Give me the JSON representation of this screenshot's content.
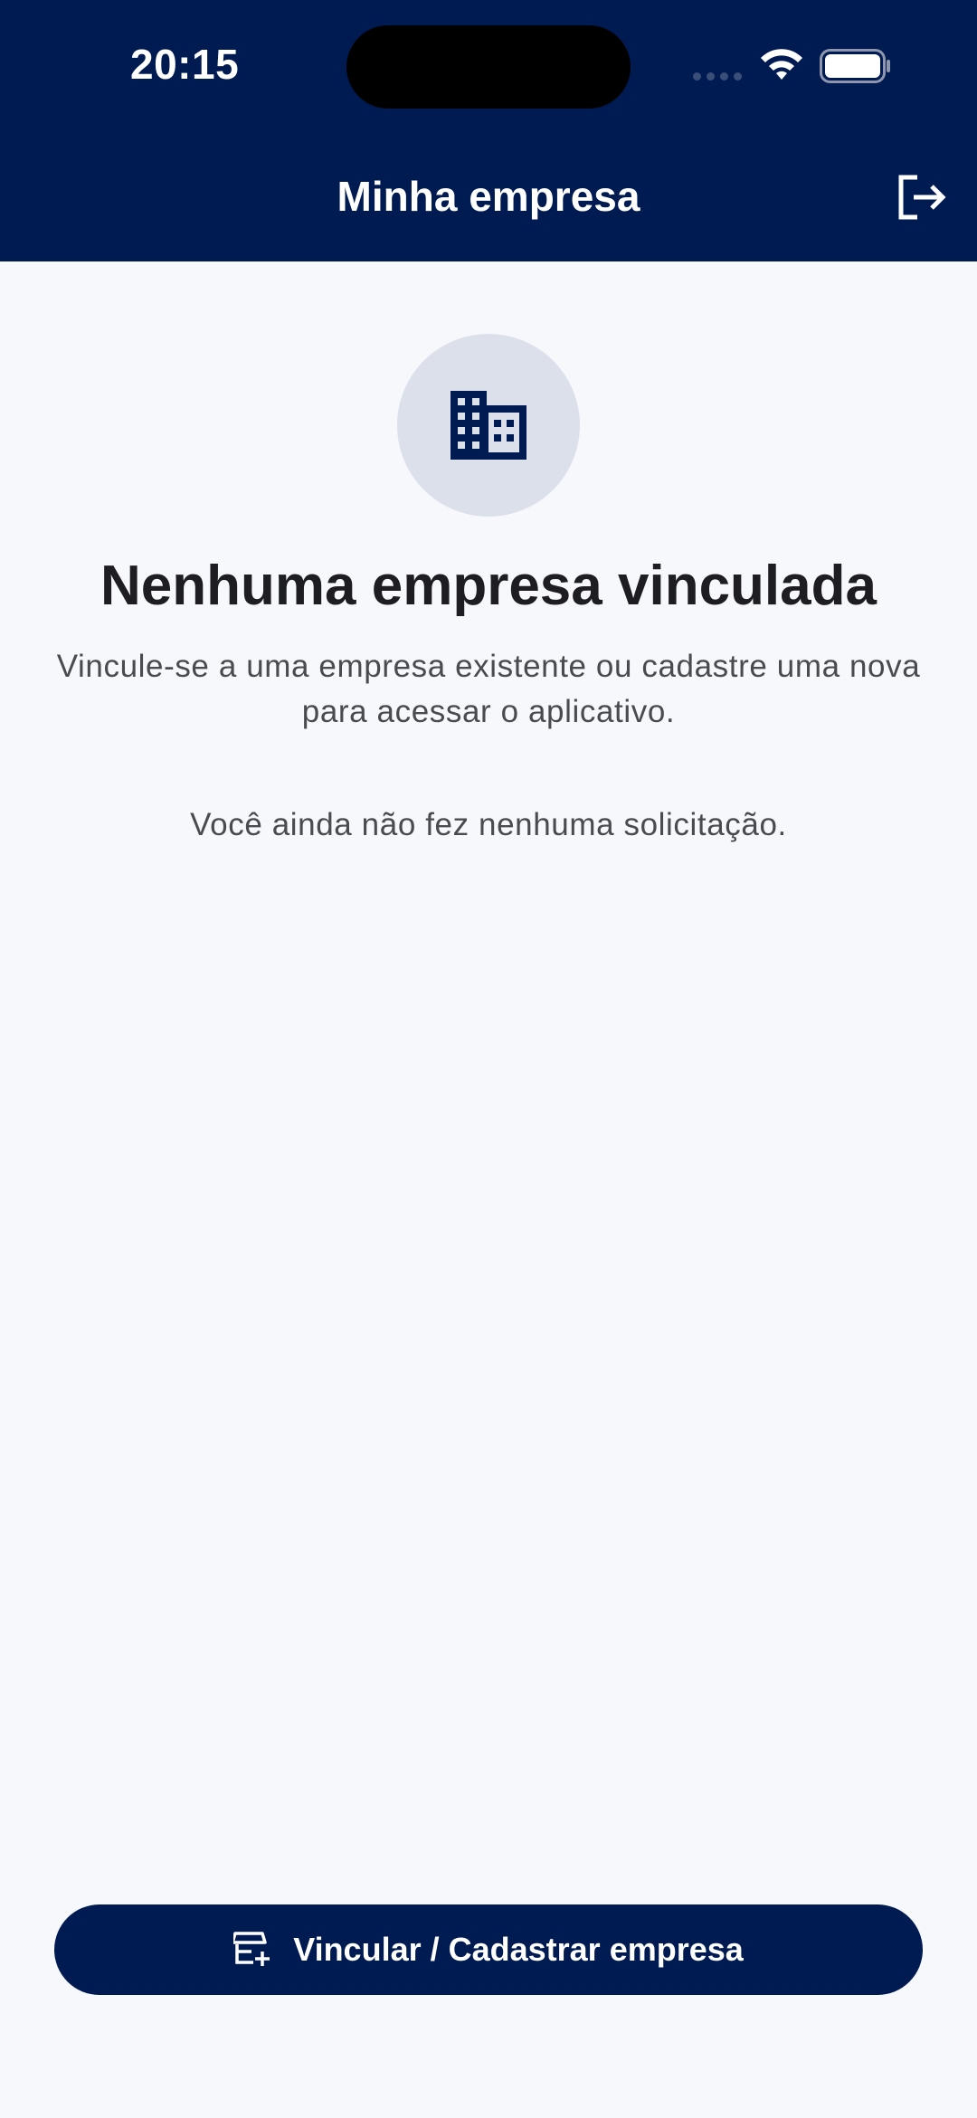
{
  "status_bar": {
    "time": "20:15"
  },
  "header": {
    "title": "Minha empresa",
    "logout_icon": "logout-icon"
  },
  "empty_state": {
    "icon": "building-icon",
    "title": "Nenhuma empresa vinculada",
    "description": "Vincule-se a uma empresa existente ou cadastre uma nova para acessar o aplicativo.",
    "no_requests": "Você ainda não fez nenhuma solicitação."
  },
  "action": {
    "icon": "store-add-icon",
    "label": "Vincular / Cadastrar empresa"
  },
  "colors": {
    "primary": "#001a52",
    "background": "#f6f8fc",
    "avatar_bg": "#dce0ea",
    "title_text": "#1e1e22",
    "body_text": "#4a4b50"
  }
}
